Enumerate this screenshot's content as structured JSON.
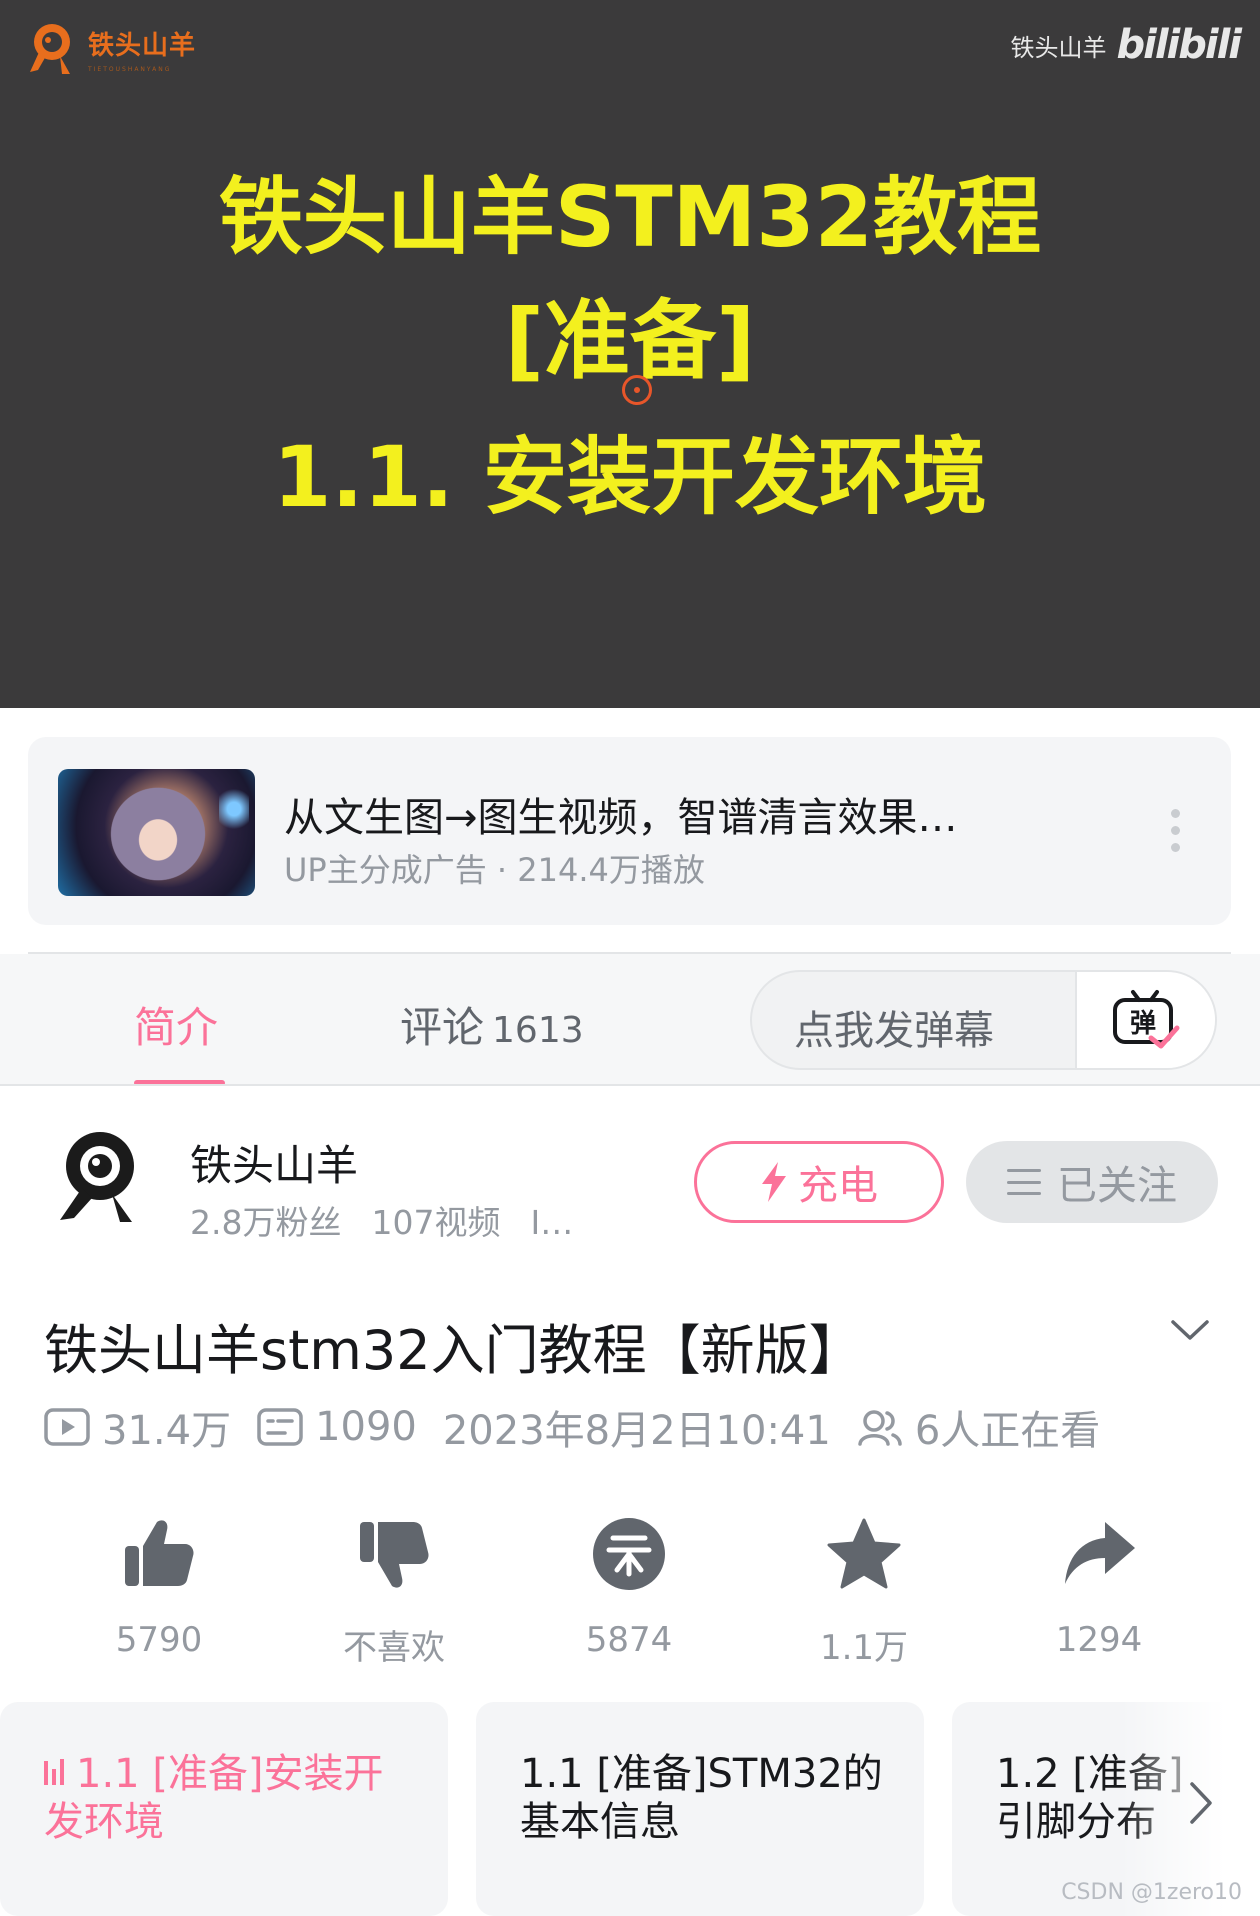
{
  "player": {
    "brand_name": "铁头山羊",
    "brand_sub": "TIETOUSHANYANG",
    "watermark_name": "铁头山羊",
    "watermark_site": "bilibili",
    "title_line1": "铁头山羊STM32教程",
    "title_line2": "[准备]",
    "title_line3": "1.1. 安装开发环境"
  },
  "ad": {
    "title": "从文生图→图生视频，智谱清言效果…",
    "meta": "UP主分成广告 · 214.4万播放",
    "more_icon": "more-vertical-icon"
  },
  "tabs": {
    "intro": "简介",
    "comments": "评论",
    "comments_count": "1613",
    "danmaku_placeholder": "点我发弹幕",
    "danmaku_icon": "danmaku-toggle-icon",
    "accent": "#fb7299"
  },
  "uploader": {
    "name": "铁头山羊",
    "fans": "2.8万粉丝",
    "videos": "107视频",
    "extra": "I…",
    "charge_label": "充电",
    "follow_label": "已关注"
  },
  "video": {
    "title": "铁头山羊stm32入门教程【新版】",
    "views": "31.4万",
    "danmaku_count": "1090",
    "date": "2023年8月2日10:41",
    "watching": "6人正在看"
  },
  "actions": {
    "like": "5790",
    "dislike": "不喜欢",
    "coin": "5874",
    "favorite": "1.1万",
    "share": "1294"
  },
  "episodes": [
    {
      "label_line1": "1.1 [准备]安装开",
      "label_line2": "发环境"
    },
    {
      "label_line1": "1.1 [准备]STM32的",
      "label_line2": "基本信息"
    },
    {
      "label_line1": "1.2 [准备]",
      "label_line2": "引脚分布"
    }
  ],
  "watermark_footer": "CSDN @1zero10"
}
